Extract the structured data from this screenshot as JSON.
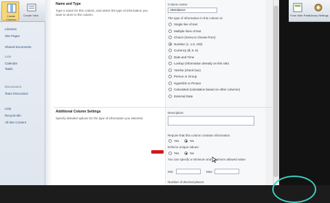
{
  "ribbon": {
    "btn1_label": "Create Column",
    "btn2_label": "Create View",
    "btn3_label": "Form Web Parts",
    "btn4_label": "Library Settings"
  },
  "sidebar": {
    "items": [
      {
        "label": "Libraries"
      },
      {
        "label": "Site Pages"
      },
      {
        "label": "Shared Documents"
      },
      {
        "label": "Lists"
      },
      {
        "label": "Calendar"
      },
      {
        "label": "Tasks"
      },
      {
        "label": "Discussions"
      },
      {
        "label": "Team Discussion"
      },
      {
        "label": "Lists"
      },
      {
        "label": "Recycle Bin"
      },
      {
        "label": "All Site Content"
      }
    ]
  },
  "name_section": {
    "title": "Name and Type",
    "description": "Type a name for this column, and select the type of information you want to store in the column."
  },
  "column_name": {
    "label": "Column name:",
    "value": "Attendance"
  },
  "type_prompt": "The type of information in this column is:",
  "types": [
    {
      "label": "Single line of text",
      "selected": false
    },
    {
      "label": "Multiple lines of text",
      "selected": false
    },
    {
      "label": "Choice (menu to choose from)",
      "selected": false
    },
    {
      "label": "Number (1, 1.0, 100)",
      "selected": true
    },
    {
      "label": "Currency ($, ¥, €)",
      "selected": false
    },
    {
      "label": "Date and Time",
      "selected": false
    },
    {
      "label": "Lookup (information already on this site)",
      "selected": false
    },
    {
      "label": "Yes/No (check box)",
      "selected": false
    },
    {
      "label": "Person or Group",
      "selected": false
    },
    {
      "label": "Hyperlink or Picture",
      "selected": false
    },
    {
      "label": "Calculated (calculation based on other columns)",
      "selected": false
    },
    {
      "label": "External Data",
      "selected": false
    }
  ],
  "additional": {
    "title": "Additional Column Settings",
    "description": "Specify detailed options for the type of information you selected.",
    "description_label": "Description:",
    "require_label": "Require that this column contains information:",
    "unique_label": "Enforce unique values:",
    "yes": "Yes",
    "no": "No",
    "minmax_label": "You can specify a minimum and maximum allowed value:",
    "min_label": "Min:",
    "max_label": "Max:",
    "decimals_label": "Number of decimal places:"
  },
  "colors": {
    "accent": "#2a4d7a",
    "marker": "#d11919",
    "ring": "#3ccfc0"
  }
}
